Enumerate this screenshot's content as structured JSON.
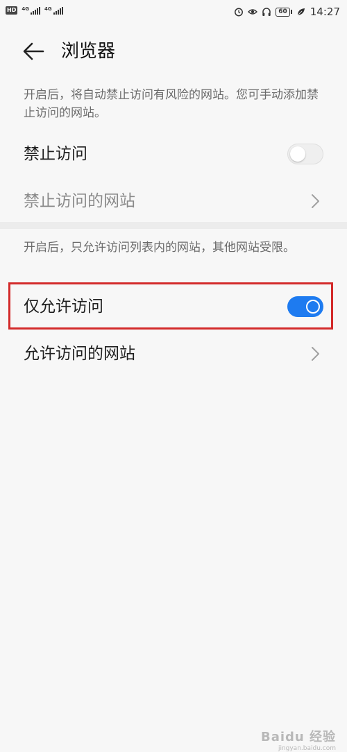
{
  "status_bar": {
    "hd_badge": "HD",
    "sim1_network": "4G",
    "sim2_network": "4G",
    "battery_level": "60",
    "time": "14:27",
    "icons": [
      "alarm-icon",
      "eye-comfort-icon",
      "headphones-icon",
      "battery-icon",
      "leaf-icon"
    ]
  },
  "header": {
    "title": "浏览器",
    "back_icon": "back-arrow-icon"
  },
  "section_block": {
    "description": "开启后，将自动禁止访问有风险的网站。您可手动添加禁止访问的网站。",
    "toggle_row": {
      "label": "禁止访问",
      "enabled": false
    },
    "link_row": {
      "label": "禁止访问的网站",
      "icon": "chevron-right-icon"
    }
  },
  "section_allow": {
    "description": "开启后，只允许访问列表内的网站，其他网站受限。",
    "toggle_row": {
      "label": "仅允许访问",
      "enabled": true
    },
    "link_row": {
      "label": "允许访问的网站",
      "icon": "chevron-right-icon"
    }
  },
  "colors": {
    "toggle_on": "#1e7bf0",
    "highlight": "#d32a2a"
  },
  "watermark": {
    "text": "Baidu 经验",
    "sub": "jingyan.baidu.com"
  }
}
